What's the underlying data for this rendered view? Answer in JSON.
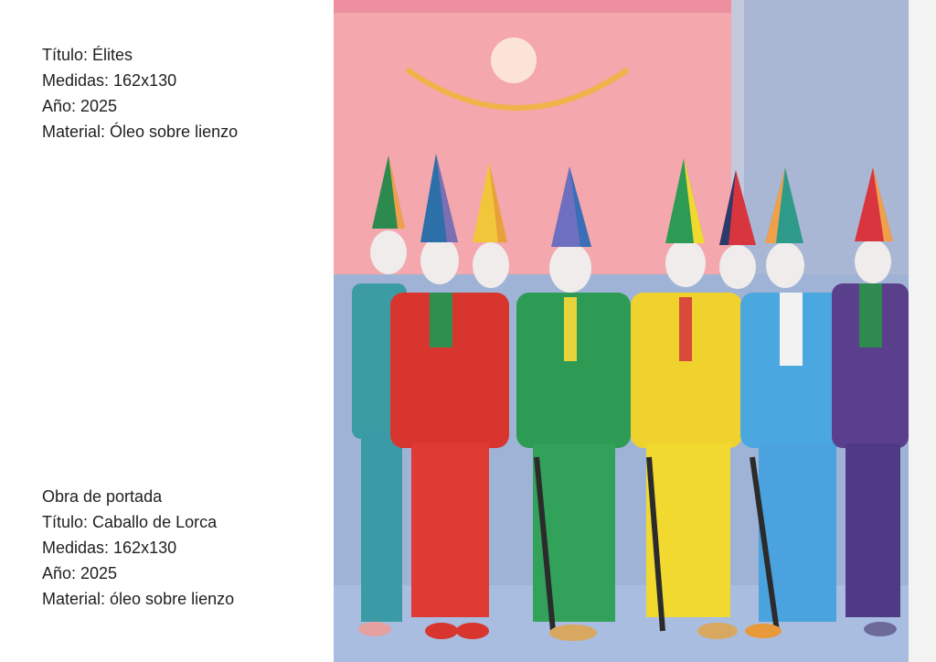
{
  "artwork_primary": {
    "title_line": "Título: Élites",
    "size_line": "Medidas: 162x130",
    "year_line": "Año: 2025",
    "material_line": "Material: Óleo sobre lienzo"
  },
  "artwork_cover": {
    "heading_line": "Obra de portada",
    "title_line": "Título: Caballo de Lorca",
    "size_line": "Medidas: 162x130",
    "year_line": "Año: 2025",
    "material_line": "Material: óleo sobre lienzo"
  },
  "colors": {
    "page_bg": "#ffffff",
    "text": "#1f1f1f",
    "sky_pink": "#f4a7ad",
    "wall_blue": "#9fb3d6"
  }
}
